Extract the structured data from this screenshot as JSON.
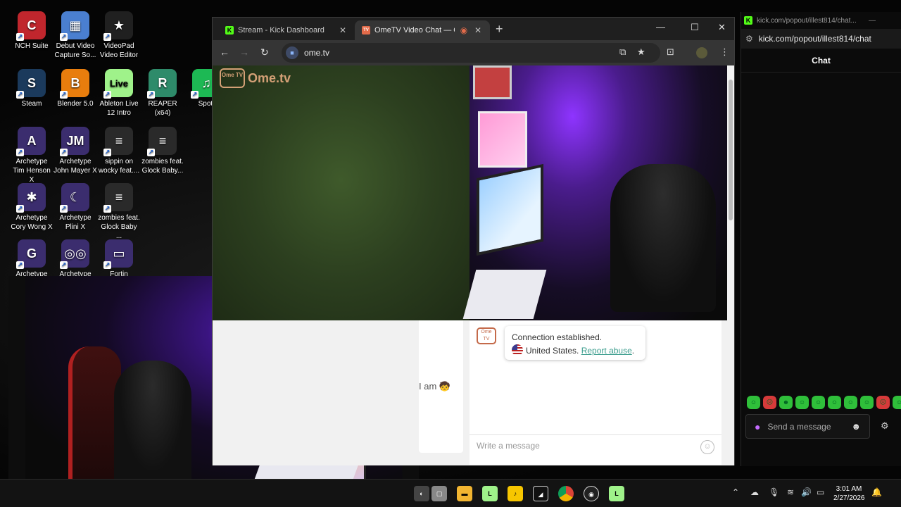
{
  "desktop": {
    "icons": [
      {
        "label": "NCH Suite",
        "glyph": "C",
        "color": "#c0262d"
      },
      {
        "label": "Debut Video Capture So...",
        "glyph": "▦",
        "color": "#4a7fd0"
      },
      {
        "label": "VideoPad Video Editor",
        "glyph": "★",
        "color": "#202020"
      },
      {
        "label": "Steam",
        "glyph": "S",
        "color": "#1b3a5c"
      },
      {
        "label": "Blender 5.0",
        "glyph": "B",
        "color": "#e87d0d"
      },
      {
        "label": "Ableton Live 12 Intro",
        "glyph": "Live",
        "color": "#9ff28a"
      },
      {
        "label": "REAPER (x64)",
        "glyph": "R",
        "color": "#2e8b6a"
      },
      {
        "label": "Spoti",
        "glyph": "♫",
        "color": "#1db954"
      },
      {
        "label": "Archetype Tim Henson X",
        "glyph": "A",
        "color": "#3b2d6e"
      },
      {
        "label": "Archetype John Mayer X",
        "glyph": "JM",
        "color": "#3b2d6e"
      },
      {
        "label": "sippin on wocky feat....",
        "glyph": "≡",
        "color": "#2a2a2a"
      },
      {
        "label": "zombies feat. Glock Baby...",
        "glyph": "≡",
        "color": "#2a2a2a"
      },
      {
        "label": "Archetype Cory Wong X",
        "glyph": "✱",
        "color": "#3b2d6e"
      },
      {
        "label": "Archetype Plini X",
        "glyph": "☾",
        "color": "#3b2d6e"
      },
      {
        "label": "zombies feat. Glock Baby ...",
        "glyph": "≡",
        "color": "#2a2a2a"
      },
      {
        "label": "Archetype",
        "glyph": "G",
        "color": "#3b2d6e"
      },
      {
        "label": "Archetype",
        "glyph": "◎◎",
        "color": "#3b2d6e"
      },
      {
        "label": "Fortin",
        "glyph": "▭",
        "color": "#3b2d6e"
      }
    ]
  },
  "browser": {
    "tabs": [
      {
        "title": "Stream - Kick Dashboard",
        "fav": "K",
        "favColor": "#53fc18"
      },
      {
        "title": "OmeTV Video Chat — Ome",
        "fav": "TV",
        "favColor": "#e36b4a"
      }
    ],
    "new_tab": "+",
    "url": "ome.tv",
    "window_controls": {
      "min": "—",
      "max": "☐",
      "close": "✕"
    }
  },
  "ome": {
    "logo_text": "Ome.tv",
    "logo_badge": "Ome TV",
    "left_chat_snippet": "I am 🧒",
    "system_message": {
      "line1": "Connection established.",
      "country": "United States.",
      "report_link": "Report abuse",
      "report_suffix": "."
    },
    "input_placeholder": "Write a message"
  },
  "kick": {
    "window_title": "kick.com/popout/illest814/chat...",
    "url": "kick.com/popout/illest814/chat",
    "chat_header": "Chat",
    "send_placeholder": "Send a message",
    "emote_count": 10
  },
  "taskbar": {
    "time": "3:01 AM",
    "date": "2/27/2026"
  }
}
